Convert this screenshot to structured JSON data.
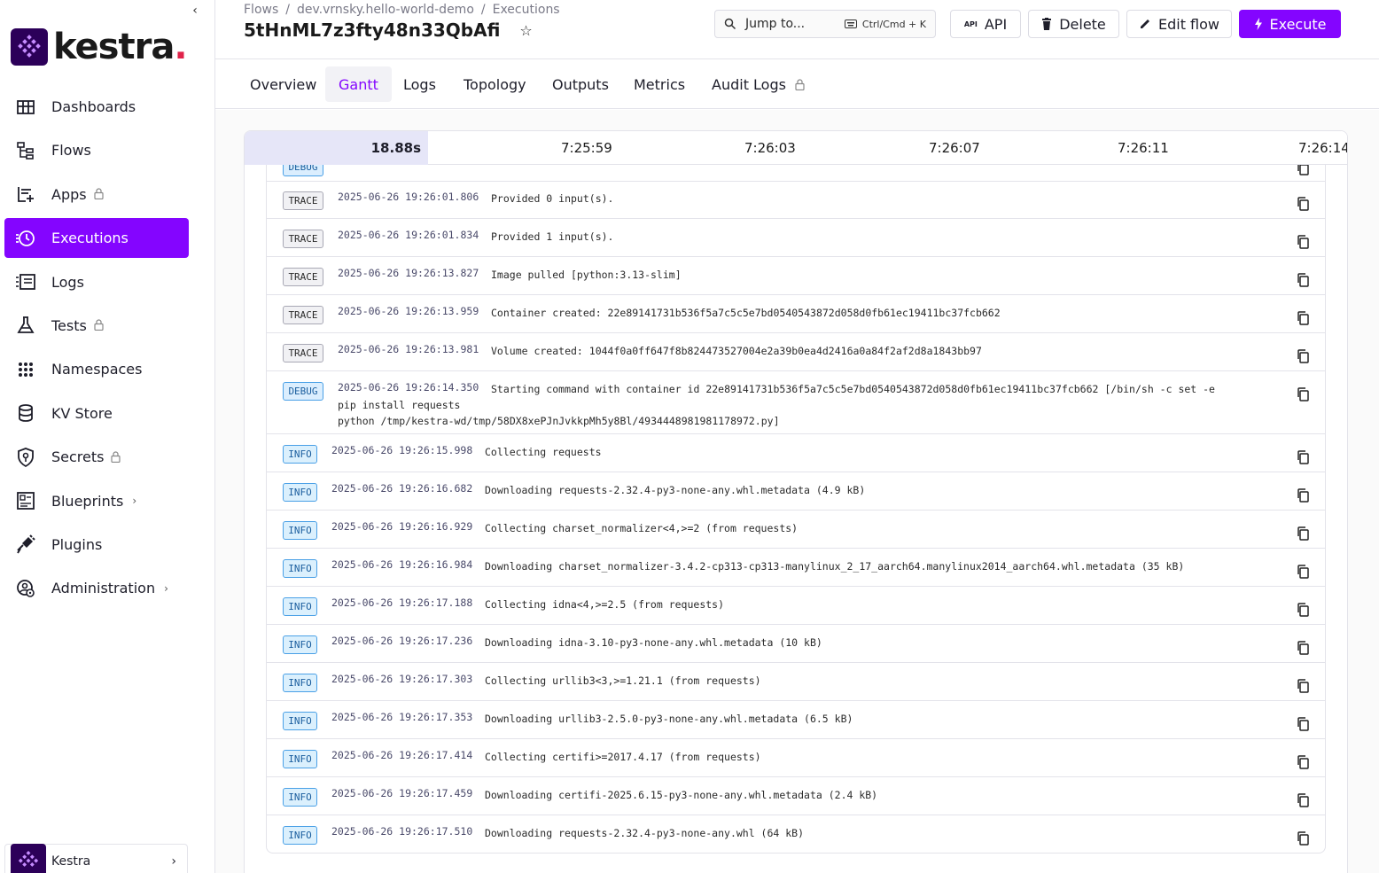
{
  "app": {
    "brand": "kestra",
    "tenant": "Kestra"
  },
  "sidebar": {
    "items": [
      {
        "label": "Dashboards",
        "icon": "dashboard-icon",
        "locked": false,
        "chevron": false,
        "active": false
      },
      {
        "label": "Flows",
        "icon": "flows-icon",
        "locked": false,
        "chevron": false,
        "active": false
      },
      {
        "label": "Apps",
        "icon": "apps-icon",
        "locked": true,
        "chevron": false,
        "active": false
      },
      {
        "label": "Executions",
        "icon": "executions-icon",
        "locked": false,
        "chevron": false,
        "active": true
      },
      {
        "label": "Logs",
        "icon": "logs-icon",
        "locked": false,
        "chevron": false,
        "active": false
      },
      {
        "label": "Tests",
        "icon": "flask-icon",
        "locked": true,
        "chevron": false,
        "active": false
      },
      {
        "label": "Namespaces",
        "icon": "grid-dots-icon",
        "locked": false,
        "chevron": false,
        "active": false
      },
      {
        "label": "KV Store",
        "icon": "database-icon",
        "locked": false,
        "chevron": false,
        "active": false
      },
      {
        "label": "Secrets",
        "icon": "shield-key-icon",
        "locked": true,
        "chevron": false,
        "active": false
      },
      {
        "label": "Blueprints",
        "icon": "blueprints-icon",
        "locked": false,
        "chevron": true,
        "active": false
      },
      {
        "label": "Plugins",
        "icon": "plug-icon",
        "locked": false,
        "chevron": false,
        "active": false
      },
      {
        "label": "Administration",
        "icon": "admin-gear-icon",
        "locked": false,
        "chevron": true,
        "active": false
      }
    ]
  },
  "header": {
    "breadcrumb": [
      "Flows",
      "dev.vrnsky.hello-world-demo",
      "Executions"
    ],
    "title": "5tHnML7z3fty48n33QbAfi",
    "jump_label": "Jump to...",
    "jump_shortcut": "Ctrl/Cmd + K",
    "api_label": "API",
    "delete_label": "Delete",
    "edit_label": "Edit flow",
    "execute_label": "Execute"
  },
  "tabs": [
    "Overview",
    "Gantt",
    "Logs",
    "Topology",
    "Outputs",
    "Metrics",
    "Audit Logs"
  ],
  "active_tab": "Gantt",
  "timeline": {
    "duration": "18.88s",
    "ticks": [
      "7:25:59",
      "7:26:03",
      "7:26:07",
      "7:26:11",
      "7:26:14"
    ]
  },
  "logs": [
    {
      "level": "TRACE",
      "ts": "2025-06-26 19:26:01.806",
      "msg": "Provided 0 input(s)."
    },
    {
      "level": "TRACE",
      "ts": "2025-06-26 19:26:01.834",
      "msg": "Provided 1 input(s)."
    },
    {
      "level": "TRACE",
      "ts": "2025-06-26 19:26:13.827",
      "msg": "Image pulled [python:3.13-slim]"
    },
    {
      "level": "TRACE",
      "ts": "2025-06-26 19:26:13.959",
      "msg": "Container created: 22e89141731b536f5a7c5c5e7bd0540543872d058d0fb61ec19411bc37fcb662"
    },
    {
      "level": "TRACE",
      "ts": "2025-06-26 19:26:13.981",
      "msg": "Volume created: 1044f0a0ff647f8b824473527004e2a39b0ea4d2416a0a84f2af2d8a1843bb97"
    },
    {
      "level": "DEBUG",
      "ts": "2025-06-26 19:26:14.350",
      "msg": "Starting command with container id 22e89141731b536f5a7c5c5e7bd0540543872d058d0fb61ec19411bc37fcb662 [/bin/sh -c set -e",
      "msg2": "pip install requests",
      "msg3": "python /tmp/kestra-wd/tmp/58DX8xePJnJvkkpMh5y8Bl/4934448981981178972.py]"
    },
    {
      "level": "INFO",
      "ts": "2025-06-26 19:26:15.998",
      "msg": "Collecting requests"
    },
    {
      "level": "INFO",
      "ts": "2025-06-26 19:26:16.682",
      "msg": "Downloading requests-2.32.4-py3-none-any.whl.metadata (4.9 kB)"
    },
    {
      "level": "INFO",
      "ts": "2025-06-26 19:26:16.929",
      "msg": "Collecting charset_normalizer<4,>=2 (from requests)"
    },
    {
      "level": "INFO",
      "ts": "2025-06-26 19:26:16.984",
      "msg": "Downloading charset_normalizer-3.4.2-cp313-cp313-manylinux_2_17_aarch64.manylinux2014_aarch64.whl.metadata (35 kB)"
    },
    {
      "level": "INFO",
      "ts": "2025-06-26 19:26:17.188",
      "msg": "Collecting idna<4,>=2.5 (from requests)"
    },
    {
      "level": "INFO",
      "ts": "2025-06-26 19:26:17.236",
      "msg": "Downloading idna-3.10-py3-none-any.whl.metadata (10 kB)"
    },
    {
      "level": "INFO",
      "ts": "2025-06-26 19:26:17.303",
      "msg": "Collecting urllib3<3,>=1.21.1 (from requests)"
    },
    {
      "level": "INFO",
      "ts": "2025-06-26 19:26:17.353",
      "msg": "Downloading urllib3-2.5.0-py3-none-any.whl.metadata (6.5 kB)"
    },
    {
      "level": "INFO",
      "ts": "2025-06-26 19:26:17.414",
      "msg": "Collecting certifi>=2017.4.17 (from requests)"
    },
    {
      "level": "INFO",
      "ts": "2025-06-26 19:26:17.459",
      "msg": "Downloading certifi-2025.6.15-py3-none-any.whl.metadata (2.4 kB)"
    },
    {
      "level": "INFO",
      "ts": "2025-06-26 19:26:17.510",
      "msg": "Downloading requests-2.32.4-py3-none-any.whl (64 kB)"
    }
  ],
  "colors": {
    "accent": "#8405ff",
    "brand_dark": "#2c0059",
    "brand_dot": "#e0234a"
  }
}
